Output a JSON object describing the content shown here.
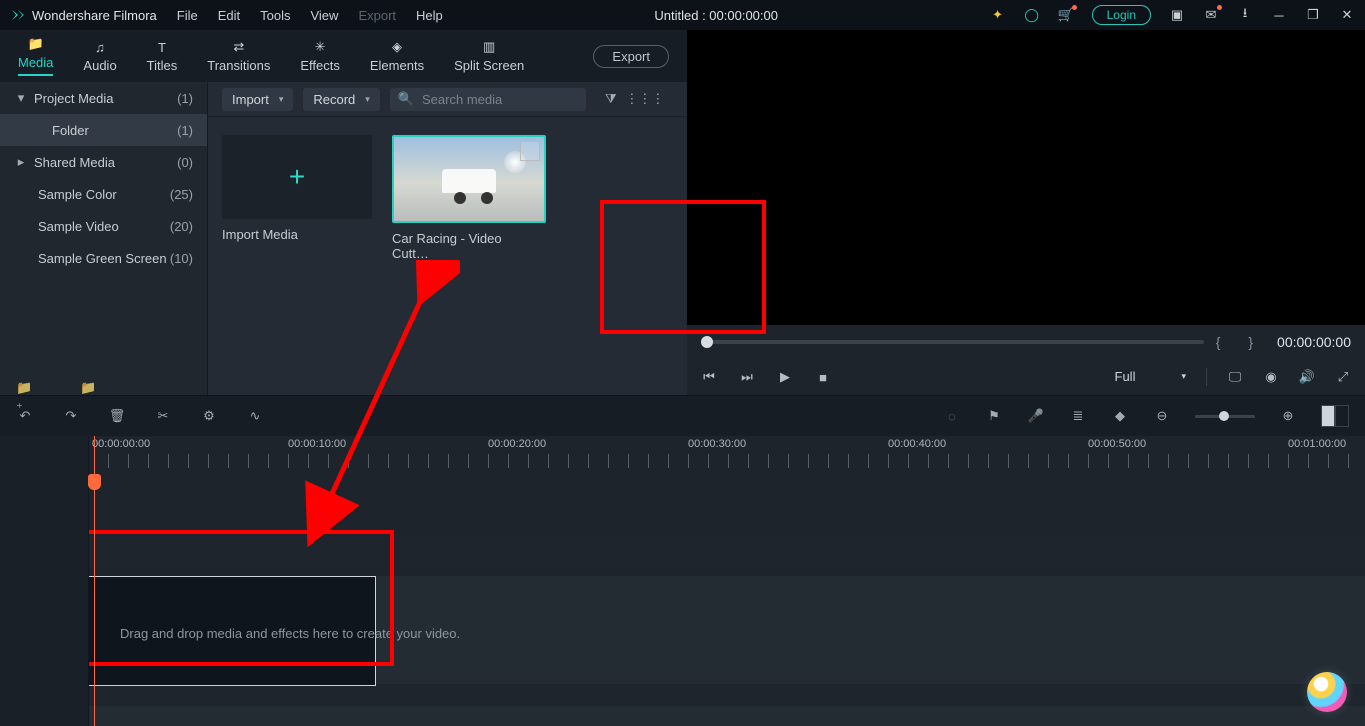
{
  "titlebar": {
    "app": "Wondershare Filmora",
    "menus": [
      "File",
      "Edit",
      "Tools",
      "View",
      "Export",
      "Help"
    ],
    "disabled_menu": "Export",
    "title": "Untitled : 00:00:00:00",
    "login": "Login"
  },
  "tabs": {
    "items": [
      {
        "label": "Media",
        "active": true
      },
      {
        "label": "Audio"
      },
      {
        "label": "Titles"
      },
      {
        "label": "Transitions"
      },
      {
        "label": "Effects"
      },
      {
        "label": "Elements"
      },
      {
        "label": "Split Screen"
      }
    ],
    "export": "Export"
  },
  "sidebar": {
    "items": [
      {
        "label": "Project Media",
        "count": "(1)",
        "chev": "▾"
      },
      {
        "label": "Folder",
        "count": "(1)",
        "sel": true,
        "indent": 2
      },
      {
        "label": "Shared Media",
        "count": "(0)",
        "chev": "▸"
      },
      {
        "label": "Sample Color",
        "count": "(25)",
        "indent": 1
      },
      {
        "label": "Sample Video",
        "count": "(20)",
        "indent": 1
      },
      {
        "label": "Sample Green Screen",
        "count": "(10)",
        "indent": 1
      }
    ]
  },
  "browser": {
    "import": "Import",
    "record": "Record",
    "search_ph": "Search media",
    "import_cell": "Import Media",
    "clip": "Car Racing - Video Cutt…"
  },
  "preview": {
    "braces": "{        }",
    "time": "00:00:00:00",
    "quality": "Full"
  },
  "ruler": {
    "labels": [
      "00:00:00:00",
      "00:00:10:00",
      "00:00:20:00",
      "00:00:30:00",
      "00:00:40:00",
      "00:00:50:00",
      "00:01:00:00"
    ]
  },
  "tracks": {
    "video": "1",
    "audio": "1"
  },
  "dropzone": "Drag and drop media and effects here to create your video."
}
